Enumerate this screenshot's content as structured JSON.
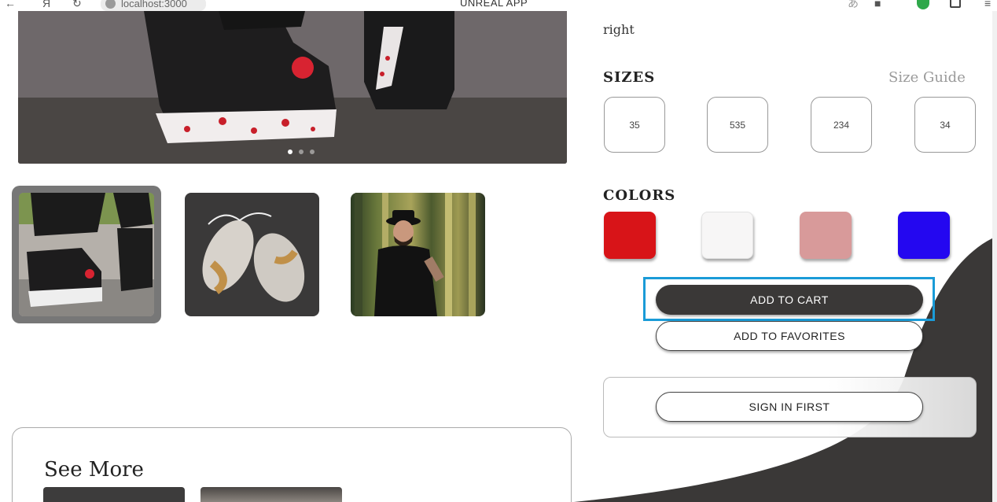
{
  "browser": {
    "back_icon": "←",
    "yandex_icon": "Я",
    "reload_icon": "↻",
    "url": "localhost:3000",
    "app_title": "UNREAL APP"
  },
  "hero": {
    "image": "sneaker-closeup-photo",
    "dots": 3,
    "active_dot": 0
  },
  "thumbnails": [
    {
      "image": "black-sneakers-on-road",
      "selected": true
    },
    {
      "image": "white-tan-sneakers-on-dark",
      "selected": false
    },
    {
      "image": "man-in-black-hat-bamboo",
      "selected": false
    }
  ],
  "see_more": {
    "title": "See More"
  },
  "product": {
    "right_text": "right",
    "sizes_title": "SIZES",
    "size_guide": "Size Guide",
    "sizes": [
      "35",
      "535",
      "234",
      "34"
    ],
    "colors_title": "COLORS",
    "colors": [
      {
        "name": "red",
        "hex": "#d81418"
      },
      {
        "name": "white",
        "hex": "#f7f6f6"
      },
      {
        "name": "pink",
        "hex": "#d89a9a"
      },
      {
        "name": "blue",
        "hex": "#2407f0"
      }
    ],
    "add_to_cart": "ADD TO CART",
    "add_to_favorites": "ADD TO FAVORITES",
    "sign_in": "SIGN IN FIRST"
  },
  "theme": {
    "dark": "#3a3837",
    "highlight": "#1a9bd7"
  }
}
